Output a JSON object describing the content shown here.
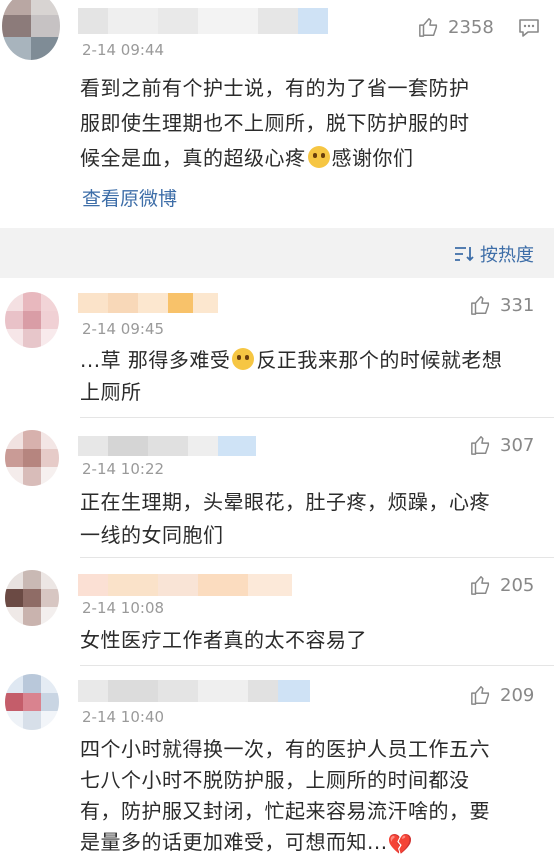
{
  "top_comment": {
    "time": "2-14 09:44",
    "likes": "2358",
    "text_line1": "看到之前有个护士说，有的为了省一套防护",
    "text_line2": "服即使生理期也不上厕所，脱下防护服的时",
    "text_line3_before_emoji": "候全是血，真的超级心疼",
    "text_line3_after_emoji": "感谢你们",
    "view_original": "查看原微博"
  },
  "sort": {
    "label": "按热度",
    "icon": "sort-lines-icon"
  },
  "comments": [
    {
      "time": "2-14 09:45",
      "likes": "331",
      "line1_before_emoji": "...草  那得多难受",
      "line1_after_emoji": "反正我来那个的时候就老想",
      "line2": "上厕所"
    },
    {
      "time": "2-14 10:22",
      "likes": "307",
      "line1": "正在生理期，头晕眼花，肚子疼，烦躁，心疼",
      "line2": "一线的女同胞们"
    },
    {
      "time": "2-14 10:08",
      "likes": "205",
      "line1": "女性医疗工作者真的太不容易了"
    },
    {
      "time": "2-14 10:40",
      "likes": "209",
      "line1": "四个小时就得换一次，有的医护人员工作五六",
      "line2": "七八个小时不脱防护服，上厕所的时间都没",
      "line3": "有，防护服又封闭，忙起来容易流汗啥的，要",
      "line4_before_heart": "是量多的话更加难受，可想而知...",
      "heart_icon": "broken-heart-icon"
    }
  ],
  "colors": {
    "link": "#3e6ea8",
    "meta_gray": "#9a9a9a",
    "background": "#f2f2f2"
  }
}
